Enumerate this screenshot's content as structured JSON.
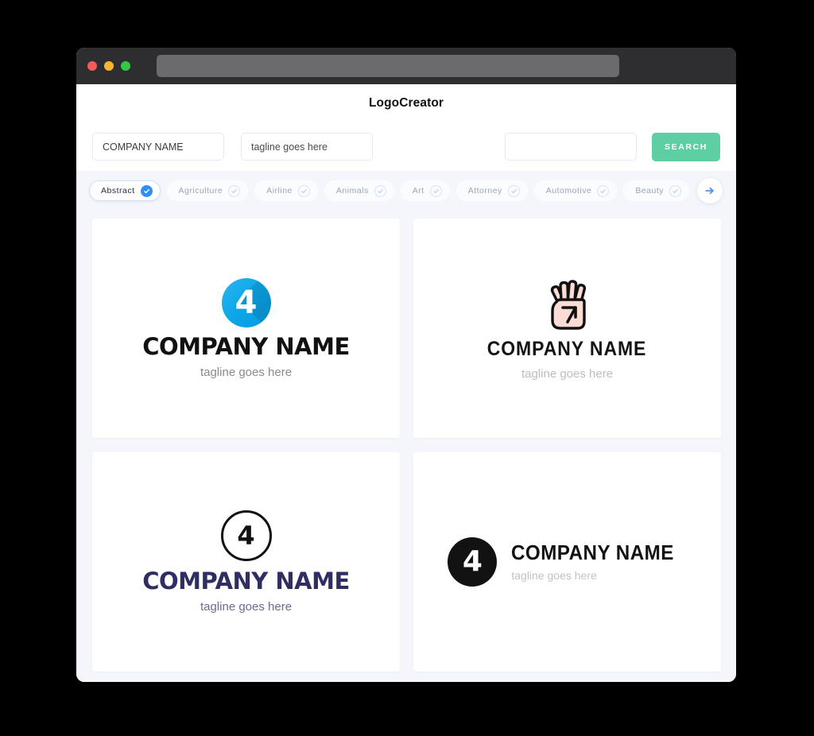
{
  "window": {
    "traffic_lights": [
      "close",
      "minimize",
      "maximize"
    ],
    "url_value": ""
  },
  "header": {
    "app_title": "LogoCreator"
  },
  "search": {
    "company_value": "COMPANY NAME",
    "company_placeholder": "COMPANY NAME",
    "tagline_value": "tagline goes here",
    "tagline_placeholder": "tagline goes here",
    "extra_value": "",
    "extra_placeholder": "",
    "search_label": "SEARCH"
  },
  "categories": {
    "items": [
      {
        "label": "Abstract",
        "selected": true
      },
      {
        "label": "Agriculture",
        "selected": false
      },
      {
        "label": "Airline",
        "selected": false
      },
      {
        "label": "Animals",
        "selected": false
      },
      {
        "label": "Art",
        "selected": false
      },
      {
        "label": "Attorney",
        "selected": false
      },
      {
        "label": "Automotive",
        "selected": false
      },
      {
        "label": "Beauty",
        "selected": false
      }
    ],
    "next_icon": "arrow-right-icon"
  },
  "results": {
    "cards": [
      {
        "id": "logo-blue-circle-four",
        "mark": "blue-gradient-circle-4",
        "digit": "4",
        "name": "COMPANY NAME",
        "tagline": "tagline goes here"
      },
      {
        "id": "logo-hand-four",
        "mark": "hand-four-fingers",
        "digit": "4",
        "name": "COMPANY NAME",
        "tagline": "tagline goes here"
      },
      {
        "id": "logo-outline-circle-four",
        "mark": "outline-circle-4",
        "digit": "4",
        "name": "COMPANY NAME",
        "tagline": "tagline goes here"
      },
      {
        "id": "logo-solid-circle-four",
        "mark": "solid-black-circle-4",
        "digit": "4",
        "name": "COMPANY NAME",
        "tagline": "tagline goes here"
      }
    ]
  },
  "colors": {
    "page_background": "#000000",
    "app_background": "#f4f6fb",
    "titlebar": "#2e2e31",
    "accent_green": "#5ecfa2",
    "accent_blue": "#2e8ff7",
    "navy": "#2e2e63",
    "light_red": "#f75a58",
    "light_yellow": "#f7b62c",
    "light_green": "#2ecc40",
    "logo_blue": "#0aa5e8",
    "hand_skin": "#fbdcd4"
  }
}
